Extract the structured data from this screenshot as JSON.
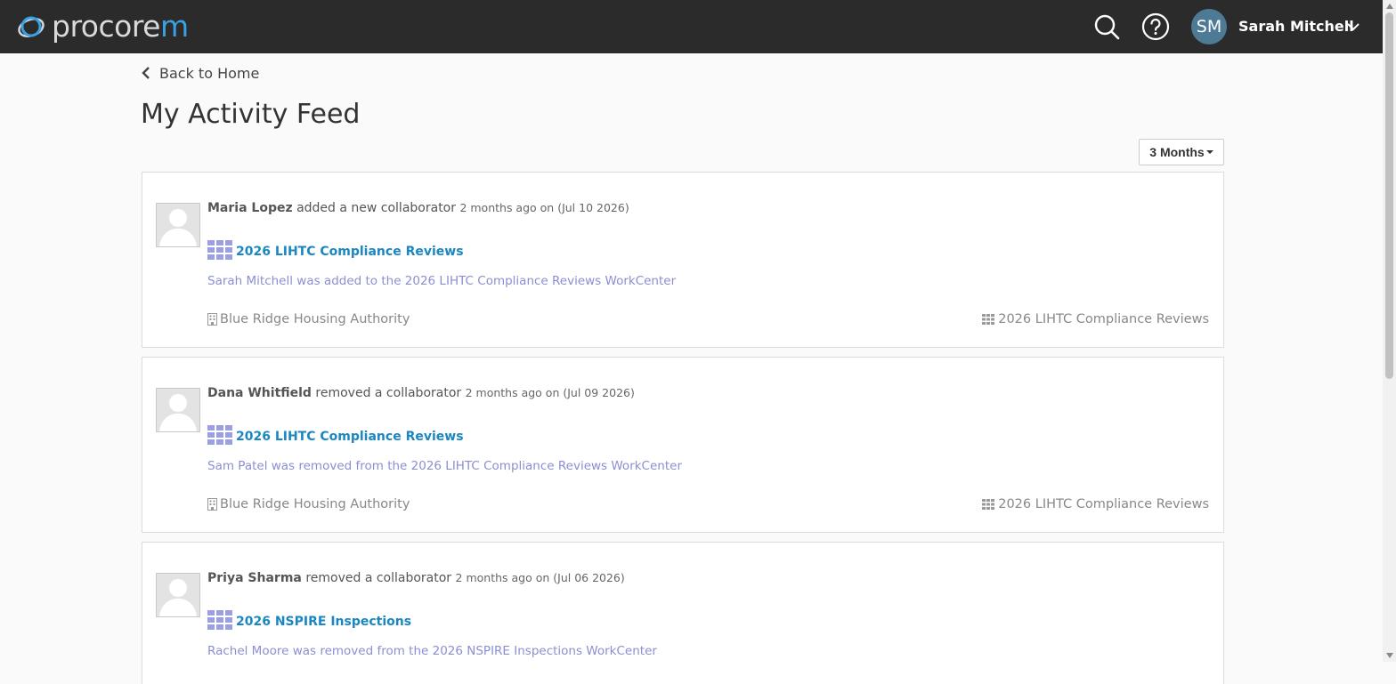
{
  "app": {
    "logo_text": "procore",
    "logo_accent": "m"
  },
  "header": {
    "user_initials": "SM",
    "user_name": "Sarah Mitchell",
    "icons": [
      "search-icon",
      "help-icon",
      "chevron-down-icon"
    ]
  },
  "nav": {
    "back_label": "Back to Home"
  },
  "page": {
    "title": "My Activity Feed",
    "range_label": "3 Months"
  },
  "colors": {
    "topbar": "#2b2b2b",
    "link_blue": "#1a87c2",
    "description_purple": "#8b8fd1",
    "avatar_bg": "#4d7b96"
  },
  "activities": [
    {
      "actor": "Maria Lopez",
      "action": "added a new collaborator",
      "when": "2 months ago on (Jul 10 2026)",
      "item_title": "2026 LIHTC Compliance Reviews",
      "description": "Sarah Mitchell was added to the 2026 LIHTC Compliance Reviews WorkCenter",
      "company": "Blue Ridge Housing Authority",
      "workcenter": "2026 LIHTC Compliance Reviews"
    },
    {
      "actor": "Dana Whitfield",
      "action": "removed a collaborator",
      "when": "2 months ago on (Jul 09 2026)",
      "item_title": "2026 LIHTC Compliance Reviews",
      "description": "Sam Patel was removed from the 2026 LIHTC Compliance Reviews WorkCenter",
      "company": "Blue Ridge Housing Authority",
      "workcenter": "2026 LIHTC Compliance Reviews"
    },
    {
      "actor": "Priya Sharma",
      "action": "removed a collaborator",
      "when": "2 months ago on (Jul 06 2026)",
      "item_title": "2026 NSPIRE Inspections",
      "description": "Rachel Moore was removed from the 2026 NSPIRE Inspections WorkCenter",
      "company": "",
      "workcenter": ""
    }
  ]
}
